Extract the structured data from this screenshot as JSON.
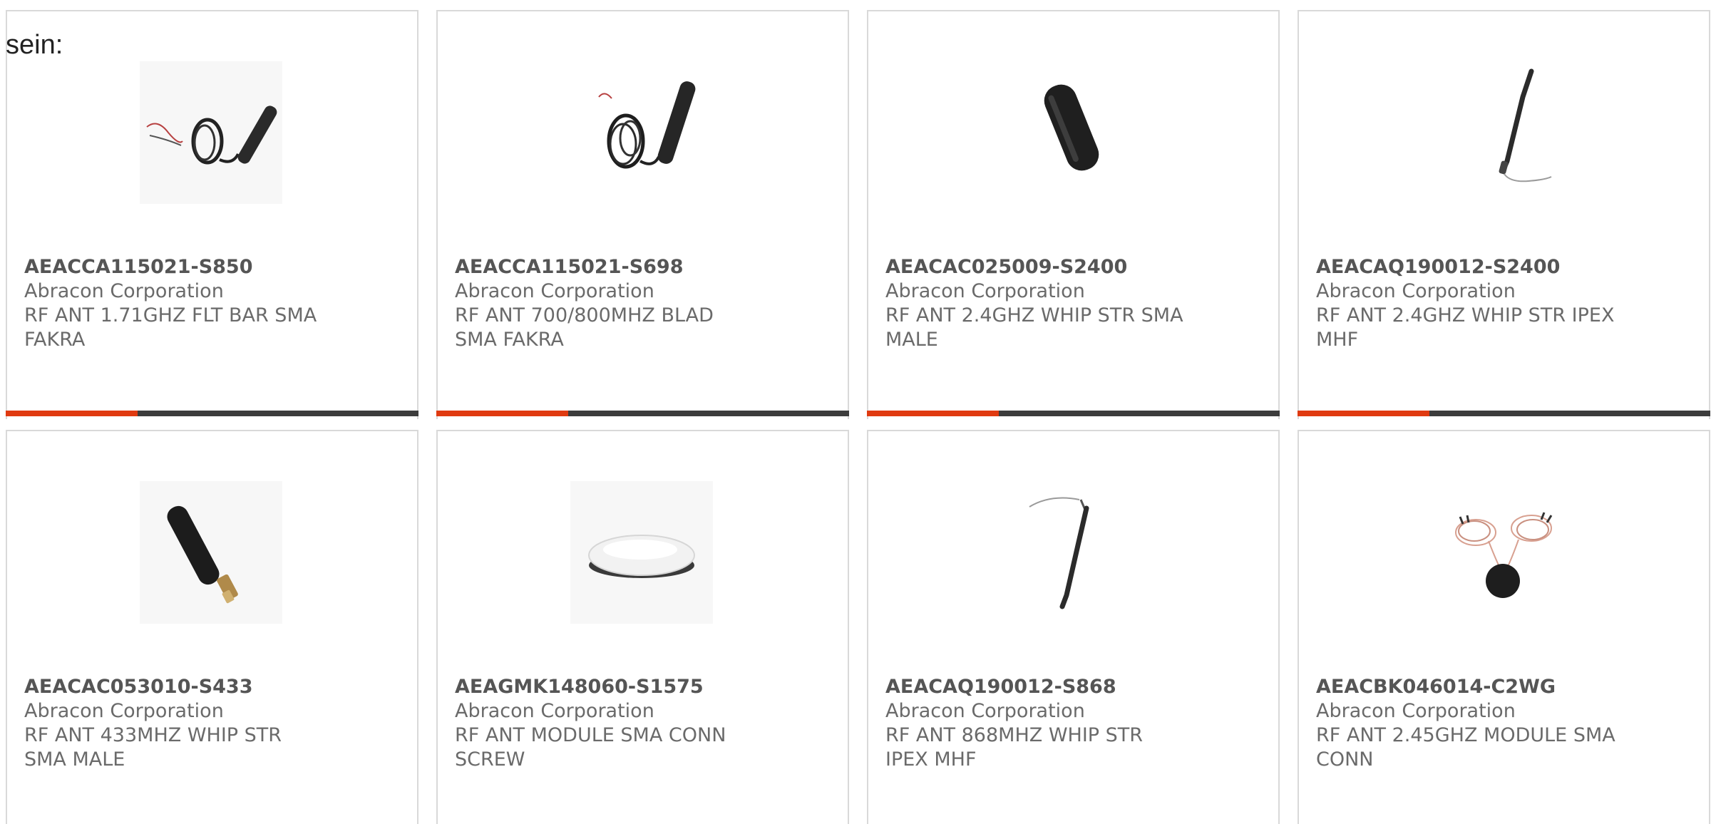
{
  "intro_text": "sein:",
  "colors": {
    "accent": "#e03a10",
    "track": "#3c3c3c",
    "card_border": "#d9d9d9",
    "text": "#6a6a6a"
  },
  "products": [
    {
      "part_number": "AEACCA115021-S850",
      "manufacturer": "Abracon Corporation",
      "description": "RF ANT 1.71GHZ FLT BAR SMA FAKRA",
      "image_icon": "antenna-cable-coil-icon",
      "progress": 0.32
    },
    {
      "part_number": "AEACCA115021-S698",
      "manufacturer": "Abracon Corporation",
      "description": "RF ANT 700/800MHZ BLAD SMA FAKRA",
      "image_icon": "antenna-blade-cable-icon",
      "progress": 0.32
    },
    {
      "part_number": "AEACAC025009-S2400",
      "manufacturer": "Abracon Corporation",
      "description": "RF ANT 2.4GHZ WHIP STR SMA MALE",
      "image_icon": "antenna-stubby-icon",
      "progress": 0.32
    },
    {
      "part_number": "AEACAQ190012-S2400",
      "manufacturer": "Abracon Corporation",
      "description": "RF ANT 2.4GHZ WHIP STR IPEX MHF",
      "image_icon": "antenna-whip-cable-icon",
      "progress": 0.32
    },
    {
      "part_number": "AEACAC053010-S433",
      "manufacturer": "Abracon Corporation",
      "description": "RF ANT 433MHZ WHIP STR SMA MALE",
      "image_icon": "antenna-sma-whip-icon",
      "progress": null
    },
    {
      "part_number": "AEAGMK148060-S1575",
      "manufacturer": "Abracon Corporation",
      "description": "RF ANT MODULE SMA CONN SCREW",
      "image_icon": "antenna-puck-icon",
      "progress": null
    },
    {
      "part_number": "AEACAQ190012-S868",
      "manufacturer": "Abracon Corporation",
      "description": "RF ANT 868MHZ WHIP STR IPEX MHF",
      "image_icon": "antenna-whip-cable-icon",
      "progress": null
    },
    {
      "part_number": "AEACBK046014-C2WG",
      "manufacturer": "Abracon Corporation",
      "description": "RF ANT 2.45GHZ MODULE SMA CONN",
      "image_icon": "antenna-module-dual-cable-icon",
      "progress": null
    }
  ]
}
